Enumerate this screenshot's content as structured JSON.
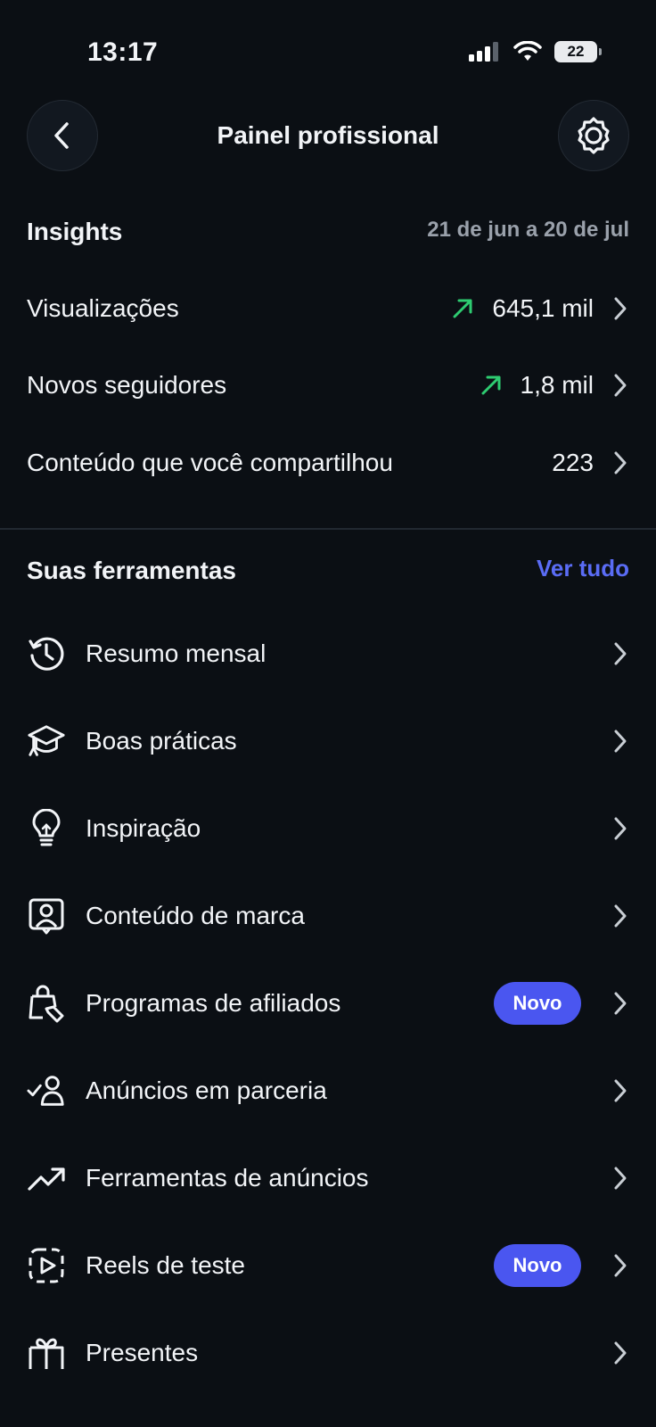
{
  "status_bar": {
    "time": "13:17",
    "battery": "22"
  },
  "header": {
    "title": "Painel profissional"
  },
  "insights": {
    "title": "Insights",
    "date_range": "21 de jun a 20 de jul",
    "rows": [
      {
        "label": "Visualizações",
        "value": "645,1 mil",
        "trend": "up"
      },
      {
        "label": "Novos seguidores",
        "value": "1,8 mil",
        "trend": "up"
      },
      {
        "label": "Conteúdo que você compartilhou",
        "value": "223",
        "trend": "none"
      }
    ]
  },
  "tools": {
    "title": "Suas ferramentas",
    "see_all": "Ver tudo",
    "items": [
      {
        "label": "Resumo mensal",
        "icon": "history-icon"
      },
      {
        "label": "Boas práticas",
        "icon": "graduation-cap-icon"
      },
      {
        "label": "Inspiração",
        "icon": "lightbulb-icon"
      },
      {
        "label": "Conteúdo de marca",
        "icon": "branded-content-icon"
      },
      {
        "label": "Programas de afiliados",
        "icon": "shopping-tag-icon",
        "badge": "Novo"
      },
      {
        "label": "Anúncios em parceria",
        "icon": "partner-check-icon"
      },
      {
        "label": "Ferramentas de anúncios",
        "icon": "trending-up-icon"
      },
      {
        "label": "Reels de teste",
        "icon": "reels-test-icon",
        "badge": "Novo"
      },
      {
        "label": "Presentes",
        "icon": "gift-icon"
      }
    ]
  },
  "colors": {
    "background": "#0b0f14",
    "accent": "#4a56f0",
    "link": "#5a6cf5",
    "trend_up": "#2ecc71"
  }
}
